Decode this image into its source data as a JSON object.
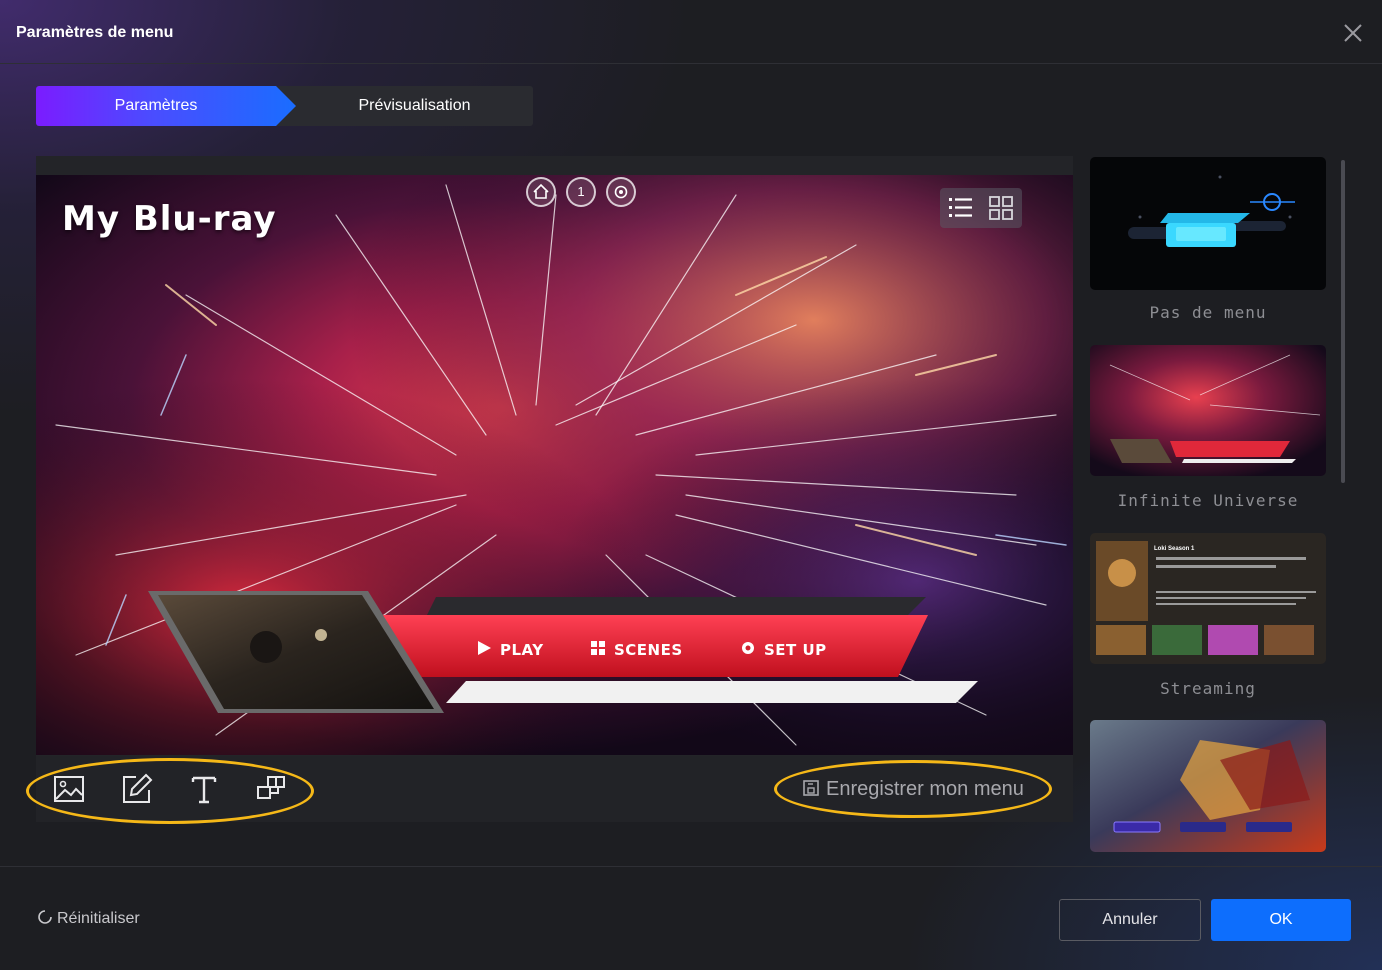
{
  "window": {
    "title": "Paramètres de menu",
    "close_icon": "close-icon"
  },
  "tabs": {
    "active": "Paramètres",
    "inactive": "Prévisualisation"
  },
  "preview": {
    "menu_title": "My Blu-ray",
    "nav_circles": [
      {
        "icon": "home-icon",
        "label": ""
      },
      {
        "icon": "page-number",
        "label": "1"
      },
      {
        "icon": "settings-icon",
        "label": ""
      }
    ],
    "view_modes": [
      "list-view-icon",
      "grid-view-icon"
    ],
    "menu_buttons": {
      "play": "PLAY",
      "scenes": "SCENES",
      "setup": "SET UP"
    }
  },
  "toolbar": {
    "tools": [
      "image-icon",
      "edit-icon",
      "text-icon",
      "layout-icon"
    ],
    "save_label": "Enregistrer mon menu",
    "highlight_color": "#f5b818"
  },
  "templates": [
    {
      "label": "Pas de menu"
    },
    {
      "label": "Infinite Universe"
    },
    {
      "label": "Streaming",
      "thumb_title": "Loki Season 1"
    },
    {
      "label": ""
    }
  ],
  "footer": {
    "reset_label": "Réinitialiser",
    "cancel_label": "Annuler",
    "ok_label": "OK"
  },
  "colors": {
    "accent": "#0d6efd",
    "tab_gradient_start": "#7b1cff",
    "menu_red": "#e0283a"
  }
}
